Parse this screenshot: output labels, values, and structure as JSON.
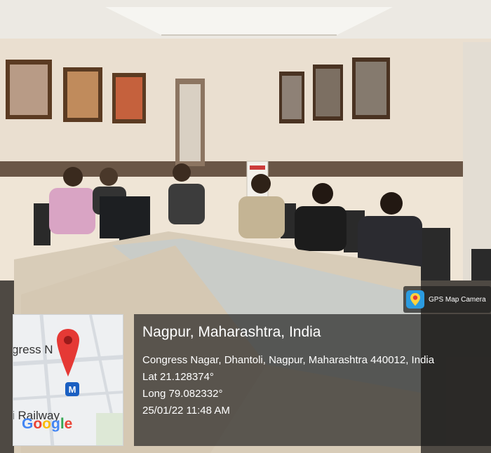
{
  "overlay": {
    "badge_text": "GPS Map Camera",
    "city": "Nagpur, Maharashtra, India",
    "address": "Congress Nagar, Dhantoli, Nagpur, Maharashtra 440012, India",
    "latitude": "Lat 21.128374°",
    "longitude": "Long 79.082332°",
    "datetime": "25/01/22 11:48 AM"
  },
  "map": {
    "label_top": "gress N",
    "label_bottom": "i Railway",
    "google_letters": [
      "G",
      "o",
      "o",
      "g",
      "l",
      "e"
    ],
    "google_colors": [
      "#4285F4",
      "#EA4335",
      "#FBBC05",
      "#4285F4",
      "#34A853",
      "#EA4335"
    ],
    "metro_glyph": "M",
    "pin_color": "#E53935"
  }
}
